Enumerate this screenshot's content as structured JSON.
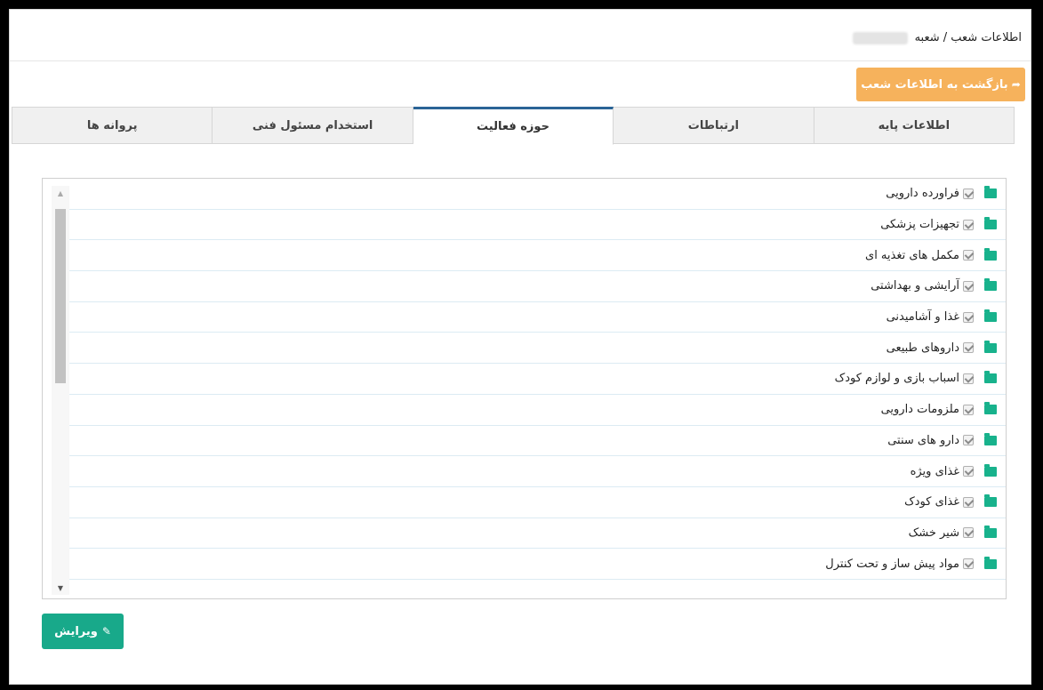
{
  "header": {
    "breadcrumb": "اطلاعات شعب / شعبه"
  },
  "back_button": {
    "label": "بازگشت به اطلاعات شعب",
    "icon": "share-arrow-icon"
  },
  "tabs": [
    {
      "label": "اطلاعات پایه",
      "active": false
    },
    {
      "label": "ارتباطات",
      "active": false
    },
    {
      "label": "حوزه فعالیت",
      "active": true
    },
    {
      "label": "استخدام مسئول فنی",
      "active": false
    },
    {
      "label": "پروانه ها",
      "active": false
    }
  ],
  "activity_list": {
    "items": [
      {
        "label": "فراورده دارویی",
        "checked": true
      },
      {
        "label": "تجهیزات پزشکی",
        "checked": true
      },
      {
        "label": "مکمل های تغذیه ای",
        "checked": true
      },
      {
        "label": "آرایشی و بهداشتی",
        "checked": true
      },
      {
        "label": "غذا و آشامیدنی",
        "checked": true
      },
      {
        "label": "داروهای طبیعی",
        "checked": true
      },
      {
        "label": "اسباب بازی و لوازم کودک",
        "checked": true
      },
      {
        "label": "ملزومات دارویی",
        "checked": true
      },
      {
        "label": "دارو های سنتی",
        "checked": true
      },
      {
        "label": "غذای ویژه",
        "checked": true
      },
      {
        "label": "غذای کودک",
        "checked": true
      },
      {
        "label": "شیر خشک",
        "checked": true
      },
      {
        "label": "مواد پیش ساز و تحت کنترل",
        "checked": true
      }
    ]
  },
  "edit_button": {
    "label": "ویرایش",
    "icon": "pencil-icon"
  },
  "colors": {
    "back_button": "#f6b25c",
    "edit_button": "#18a98a",
    "folder_icon": "#18b28c",
    "active_tab_border": "#2a6496"
  }
}
